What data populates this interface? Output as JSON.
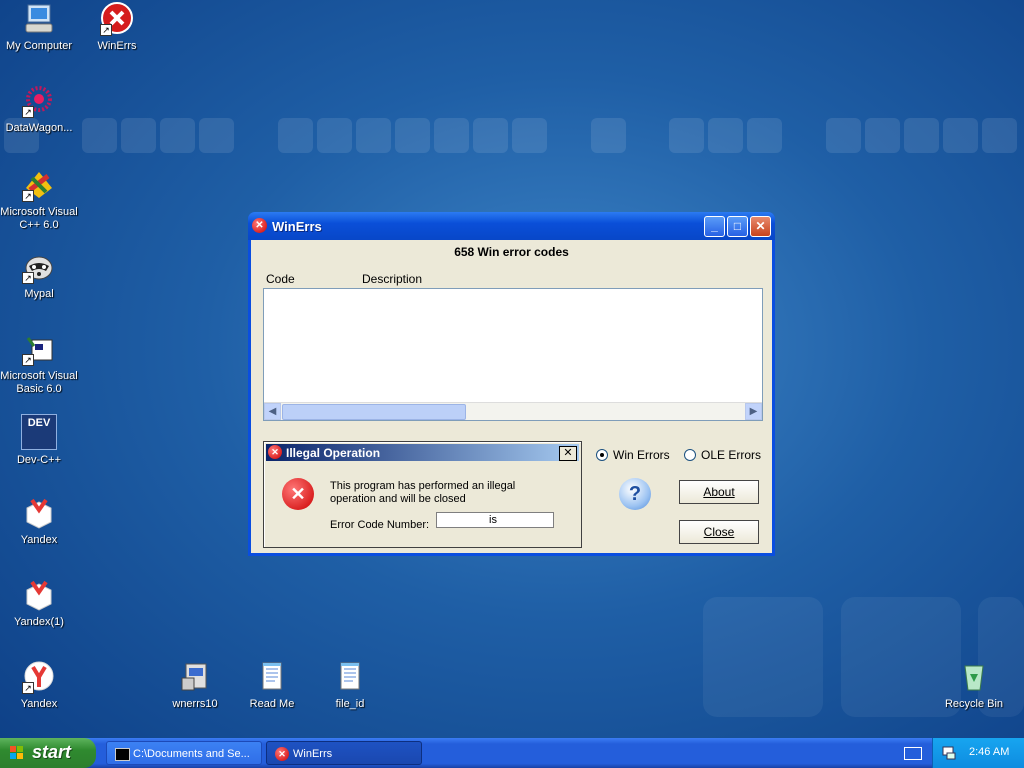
{
  "desktop": {
    "icons": [
      {
        "label": "My Computer"
      },
      {
        "label": "WinErrs"
      },
      {
        "label": "DataWagon..."
      },
      {
        "label": "Microsoft Visual C++ 6.0"
      },
      {
        "label": "Mypal"
      },
      {
        "label": "Microsoft Visual Basic 6.0"
      },
      {
        "label": "Dev-C++"
      },
      {
        "label": "Yandex"
      },
      {
        "label": "Yandex(1)"
      },
      {
        "label": "Yandex"
      },
      {
        "label": "wnerrs10"
      },
      {
        "label": "Read Me"
      },
      {
        "label": "file_id"
      },
      {
        "label": "Recycle Bin"
      }
    ],
    "devcpp_icon_text": "DEV"
  },
  "window": {
    "title": "WinErrs",
    "heading": "658 Win error codes",
    "columns": [
      "Code",
      "Description"
    ],
    "radio_win": "Win Errors",
    "radio_ole": "OLE Errors",
    "radio_selected": "Win Errors",
    "about_label": "About",
    "close_label": "Close",
    "help_glyph": "?"
  },
  "dialog": {
    "title": "Illegal Operation",
    "message": "This program has performed an illegal operation and will be closed",
    "field_label": "Error Code Number:",
    "field_value": "is"
  },
  "taskbar": {
    "start_label": "start",
    "tasks": [
      {
        "label": "C:\\Documents and Se..."
      },
      {
        "label": "WinErrs"
      }
    ],
    "clock": "2:46 AM"
  }
}
